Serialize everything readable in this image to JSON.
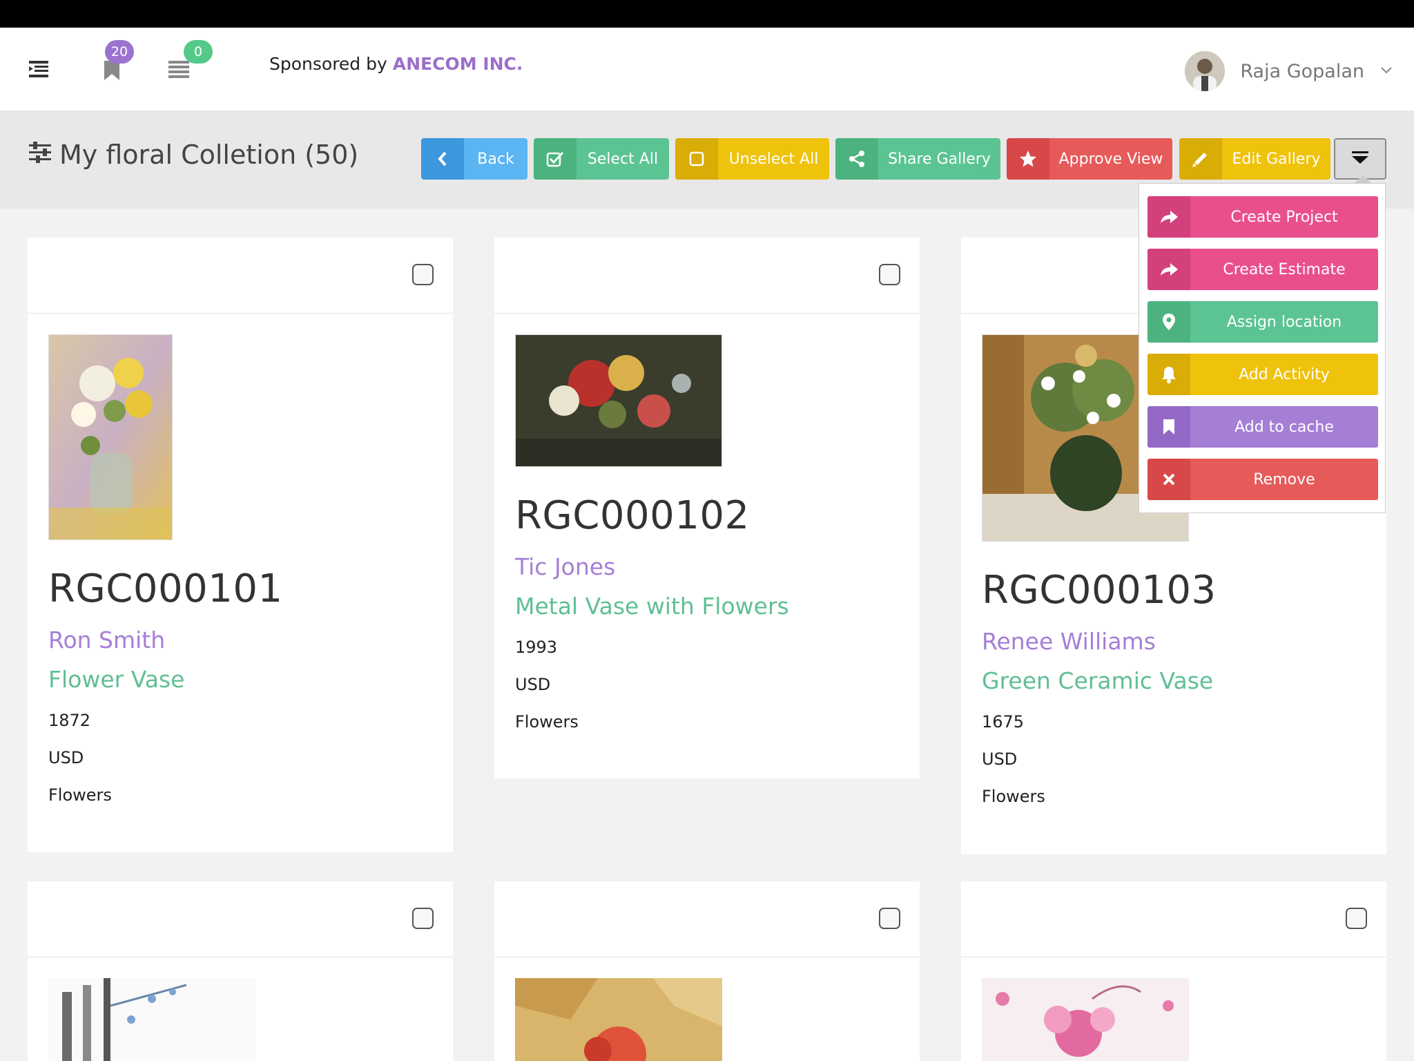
{
  "header": {
    "bookmarks_badge": "20",
    "list_badge": "0",
    "sponsor_prefix": "Sponsored by",
    "sponsor_brand": "ANECOM INC.",
    "user_name": "Raja Gopalan"
  },
  "toolbar": {
    "title": "My floral Colletion (50)",
    "buttons": {
      "back": "Back",
      "select_all": "Select All",
      "unselect_all": "Unselect All",
      "share_gallery": "Share Gallery",
      "approve_view": "Approve View",
      "edit_gallery": "Edit Gallery"
    }
  },
  "dropdown": {
    "items": [
      {
        "label": "Create Project",
        "icon": "share-arrow-icon"
      },
      {
        "label": "Create Estimate",
        "icon": "share-arrow-icon"
      },
      {
        "label": "Assign location",
        "icon": "map-pin-icon"
      },
      {
        "label": "Add Activity",
        "icon": "bell-icon"
      },
      {
        "label": "Add to cache",
        "icon": "bookmark-icon"
      },
      {
        "label": "Remove",
        "icon": "close-icon"
      }
    ]
  },
  "cards": [
    {
      "code": "RGC000101",
      "artist": "Ron Smith",
      "title": "Flower Vase",
      "year": "1872",
      "currency": "USD",
      "category": "Flowers"
    },
    {
      "code": "RGC000102",
      "artist": "Tic Jones",
      "title": "Metal Vase with Flowers",
      "year": "1993",
      "currency": "USD",
      "category": "Flowers"
    },
    {
      "code": "RGC000103",
      "artist": "Renee Williams",
      "title": "Green Ceramic Vase",
      "year": "1675",
      "currency": "USD",
      "category": "Flowers"
    }
  ],
  "colors": {
    "blue": "#4aa8e8",
    "green": "#5cc493",
    "yellow": "#efc20c",
    "red": "#e75a5a",
    "pink": "#ea4f8d",
    "purple": "#a57ed6",
    "badge_purple": "#9b72d0",
    "badge_green": "#55c98a"
  }
}
